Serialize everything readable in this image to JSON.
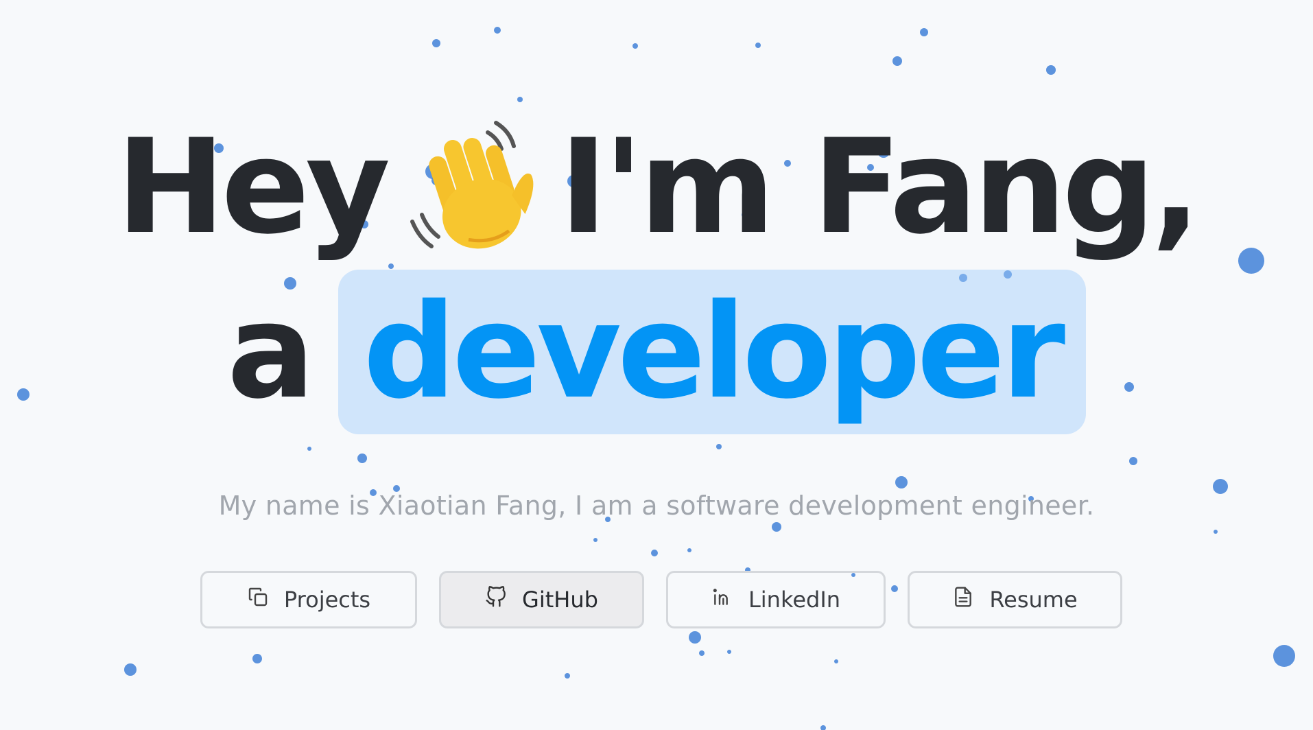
{
  "hero": {
    "greeting": "Hey",
    "wave_icon": "waving-hand-icon",
    "intro": "I'm Fang,",
    "article": "a",
    "role": "developer",
    "subtitle": "My name is Xiaotian Fang, I am a software development engineer."
  },
  "buttons": [
    {
      "label": "Projects",
      "icon": "copy-icon"
    },
    {
      "label": "GitHub",
      "icon": "github-icon"
    },
    {
      "label": "LinkedIn",
      "icon": "linkedin-icon"
    },
    {
      "label": "Resume",
      "icon": "document-icon"
    }
  ],
  "colors": {
    "background": "#f7f9fb",
    "headline": "#26292e",
    "accent": "#0394f5",
    "highlight": "#cde3fb",
    "particle": "#4a87d9",
    "subtitle": "#a1a6ad"
  }
}
